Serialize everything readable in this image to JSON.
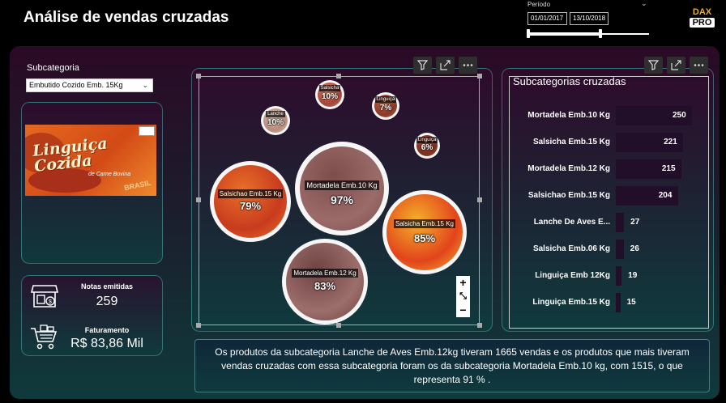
{
  "header": {
    "title": "Análise de vendas cruzadas",
    "period_label": "Período",
    "date_start": "01/01/2017",
    "date_end": "13/10/2018",
    "range_start_fraction": 0.0,
    "range_end_fraction": 0.6,
    "logo_line1": "DAX",
    "logo_line2": "PRO"
  },
  "filter": {
    "label": "Subcategoria",
    "selected": "Embutido Cozido Emb. 15Kg"
  },
  "product_image": {
    "brand": "Linguiça Cozida",
    "subtitle": "de Carne Bovina",
    "origin": "BRASIL"
  },
  "kpis": {
    "notas_title": "Notas emitidas",
    "notas_value": "259",
    "faturamento_title": "Faturamento",
    "faturamento_value": "R$ 83,86 Mil"
  },
  "bubbles": [
    {
      "label": "Mortadela Emb.10 Kg",
      "pct": "97%",
      "color": "#9a6b69",
      "accent": "#7d4d4c"
    },
    {
      "label": "Salsichao Emb.15 Kg",
      "pct": "79%",
      "color": "#c83b1d",
      "accent": "#e9702a"
    },
    {
      "label": "Salsicha Emb.15 Kg",
      "pct": "85%",
      "color": "#e2441c",
      "accent": "#f4b02a"
    },
    {
      "label": "Mortadela Emb.12 Kg",
      "pct": "83%",
      "color": "#9c6e6c",
      "accent": "#6d4341"
    },
    {
      "label": "Salsicha",
      "pct": "10%",
      "color": "#a3443a",
      "accent": "#d88a6a"
    },
    {
      "label": "Lanche",
      "pct": "10%",
      "color": "#b88a7a",
      "accent": "#d8c0b0"
    },
    {
      "label": "Linguiça",
      "pct": "7%",
      "color": "#8a3a2a",
      "accent": "#c06040"
    },
    {
      "label": "Linguiça",
      "pct": "6%",
      "color": "#7a3022",
      "accent": "#b04c30"
    }
  ],
  "bar_chart": {
    "title": "Subcategorias cruzadas",
    "items": [
      {
        "label": "Mortadela Emb.10 Kg",
        "value": 250
      },
      {
        "label": "Salsicha Emb.15 Kg",
        "value": 221
      },
      {
        "label": "Mortadela Emb.12 Kg",
        "value": 215
      },
      {
        "label": "Salsichao Emb.15 Kg",
        "value": 204
      },
      {
        "label": "Lanche De Aves E...",
        "value": 27
      },
      {
        "label": "Salsicha Emb.06 Kg",
        "value": 26
      },
      {
        "label": "Linguiça Emb 12Kg",
        "value": 19
      },
      {
        "label": "Linguiça Emb.15 Kg",
        "value": 15
      }
    ]
  },
  "summary": "Os produtos da subcategoria Lanche de Aves Emb.12kg tiveram 1665 vendas e os produtos que mais tiveram vendas cruzadas com essa subcategoria foram os da subcategoria Mortadela Emb.10 kg, com 1515, o que representa 91 % .",
  "zoom": {
    "plus": "+",
    "minus": "−",
    "fit": "⤡"
  },
  "colors": {
    "accent_teal": "#5ac8be",
    "bar": "#210e28",
    "logo_orange": "#f2b01e"
  }
}
